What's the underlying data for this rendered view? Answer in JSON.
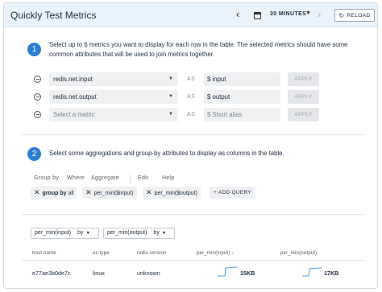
{
  "header": {
    "title": "Quickly Test Metrics",
    "time_range": "30 MINUTES",
    "reload_label": "RELOAD"
  },
  "step1": {
    "number": "1",
    "text_line1": "Select up to 6 metrics you want to display for each row in the table. The selected metrics should have some",
    "text_line2": "common attributes that will be used to join metrics together.",
    "rows": [
      {
        "metric": "redis.net.input",
        "as": "AS",
        "alias": "$ input",
        "apply": "APPLY"
      },
      {
        "metric": "redis.net.output",
        "as": "AS",
        "alias": "$ output",
        "apply": "APPLY"
      },
      {
        "metric": "Select a metric",
        "as": "AS",
        "alias": "$ Short alias",
        "apply": "APPLY"
      }
    ]
  },
  "step2": {
    "number": "2",
    "text": "Select some aggregations and group-by attributes to display as columns in the table.",
    "menu": [
      "Group by",
      "Where",
      "Aggregate",
      "Edit",
      "Help"
    ],
    "chips": [
      {
        "bold": "group by",
        "rest": " all"
      },
      {
        "bold": "",
        "rest": "per_min($input)"
      },
      {
        "bold": "",
        "rest": "per_min($output)"
      }
    ],
    "add_query": "+ ADD QUERY"
  },
  "results": {
    "column_selects": [
      {
        "name": "per_min(input)",
        "by": "by"
      },
      {
        "name": "per_min(output)",
        "by": "by"
      }
    ],
    "columns": [
      "host.name",
      "os.type",
      "redis.version",
      "per_min(input)",
      "per_min(output)"
    ],
    "sort_indicator": "↓",
    "rows": [
      {
        "host": "e77ae3b0de7c",
        "os": "linux",
        "version": "unknown",
        "input": "15KB",
        "output": "17KB"
      }
    ]
  },
  "colors": {
    "header_bg": "#e9f3fc",
    "step_accent": "#2c7fd0",
    "sparkline": "#4a9fe0"
  }
}
